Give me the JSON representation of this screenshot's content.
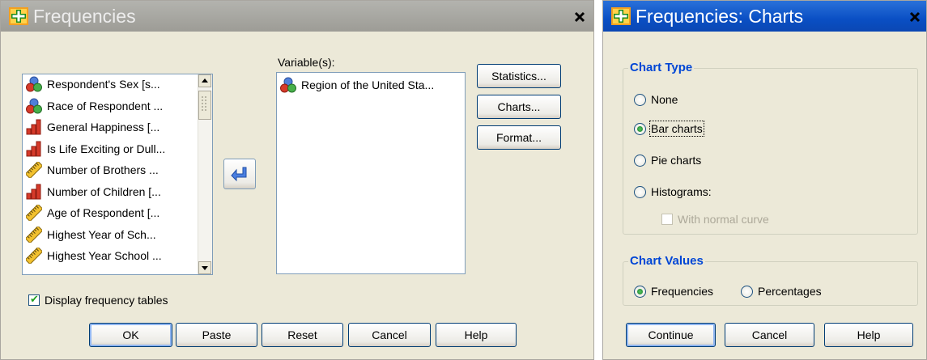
{
  "frequencies_dialog": {
    "title": "Frequencies",
    "variables_list": [
      {
        "label": "Respondent's Sex [s...",
        "icon": "nominal-icon"
      },
      {
        "label": "Race of Respondent ...",
        "icon": "nominal-icon"
      },
      {
        "label": "General Happiness [...",
        "icon": "ordinal-icon"
      },
      {
        "label": "Is Life Exciting or Dull...",
        "icon": "ordinal-icon"
      },
      {
        "label": "Number of Brothers ...",
        "icon": "scale-icon"
      },
      {
        "label": "Number of Children [...",
        "icon": "ordinal-icon"
      },
      {
        "label": "Age of Respondent [...",
        "icon": "scale-icon"
      },
      {
        "label": "Highest Year of Sch...",
        "icon": "scale-icon"
      },
      {
        "label": "Highest Year School ...",
        "icon": "scale-icon"
      }
    ],
    "selected_variables_label": "Variable(s):",
    "selected_variables": [
      {
        "label": "Region of the United Sta...",
        "icon": "nominal-icon"
      }
    ],
    "side_buttons": {
      "statistics": "Statistics...",
      "charts": "Charts...",
      "format": "Format..."
    },
    "display_tables_label": "Display frequency tables",
    "display_tables_checked": true,
    "bottom_buttons": {
      "ok": "OK",
      "paste": "Paste",
      "reset": "Reset",
      "cancel": "Cancel",
      "help": "Help"
    }
  },
  "charts_dialog": {
    "title": "Frequencies: Charts",
    "chart_type": {
      "title": "Chart Type",
      "options": {
        "none": "None",
        "bar": "Bar charts",
        "pie": "Pie charts",
        "histograms": "Histograms:"
      },
      "selected": "bar",
      "normal_curve_label": "With normal curve"
    },
    "chart_values": {
      "title": "Chart Values",
      "frequencies": "Frequencies",
      "percentages": "Percentages",
      "selected": "frequencies"
    },
    "buttons": {
      "continue": "Continue",
      "cancel": "Cancel",
      "help": "Help"
    }
  },
  "colors": {
    "dialog_bg": "#ece9d8",
    "inactive_title": "#9d9c96",
    "active_title": "#0a4fc4",
    "group_title": "#0046d5"
  }
}
